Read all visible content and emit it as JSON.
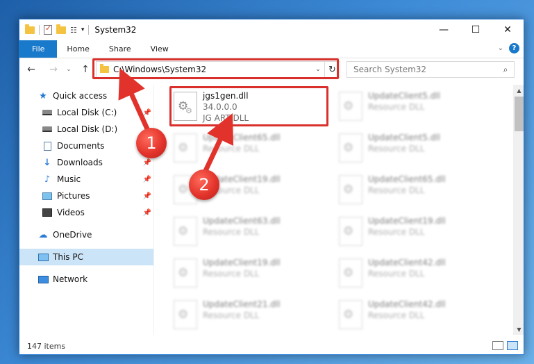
{
  "window": {
    "title": "System32",
    "minimize_glyph": "—",
    "maximize_glyph": "☐",
    "close_glyph": "✕"
  },
  "quick_access_toolbar": {
    "view_glyph": "☷",
    "caret_glyph": "▾"
  },
  "ribbon": {
    "tabs": [
      "File",
      "Home",
      "Share",
      "View"
    ],
    "help_label": "?",
    "expand_glyph": "⌄"
  },
  "nav": {
    "back_glyph": "←",
    "forward_glyph": "→",
    "recent_glyph": "⌄",
    "up_glyph": "↑"
  },
  "address_bar": {
    "path": "C:\\Windows\\System32",
    "dropdown_glyph": "⌄",
    "refresh_glyph": "↻"
  },
  "search": {
    "placeholder": "Search System32",
    "icon_glyph": "⌕"
  },
  "sidebar": {
    "items": [
      {
        "label": "Quick access",
        "icon": "star-icon"
      },
      {
        "label": "Local Disk (C:)",
        "icon": "drive-icon",
        "pinned": true
      },
      {
        "label": "Local Disk (D:)",
        "icon": "drive-icon"
      },
      {
        "label": "Documents",
        "icon": "documents-icon"
      },
      {
        "label": "Downloads",
        "icon": "download-icon",
        "pinned": true
      },
      {
        "label": "Music",
        "icon": "music-icon",
        "pinned": true
      },
      {
        "label": "Pictures",
        "icon": "pictures-icon",
        "pinned": true
      },
      {
        "label": "Videos",
        "icon": "videos-icon",
        "pinned": true
      },
      {
        "label": "OneDrive",
        "icon": "cloud-icon"
      },
      {
        "label": "This PC",
        "icon": "computer-icon",
        "selected": true
      },
      {
        "label": "Network",
        "icon": "network-icon"
      }
    ]
  },
  "files": [
    {
      "name": "jgs1gen.dll",
      "line2": "34.0.0.0",
      "line3": "JG ART DLL",
      "highlighted": true
    },
    {
      "name": "UpdateClient5.dll",
      "line2": "Resource DLL"
    },
    {
      "name": "UpdateClient65.dll",
      "line2": "Resource DLL"
    },
    {
      "name": "UpdateClient5.dll",
      "line2": "Resource DLL"
    },
    {
      "name": "UpdateClient19.dll",
      "line2": "Resource DLL"
    },
    {
      "name": "UpdateClient65.dll",
      "line2": "Resource DLL"
    },
    {
      "name": "UpdateClient63.dll",
      "line2": "Resource DLL"
    },
    {
      "name": "UpdateClient19.dll",
      "line2": "Resource DLL"
    },
    {
      "name": "UpdateClient19.dll",
      "line2": "Resource DLL"
    },
    {
      "name": "UpdateClient42.dll",
      "line2": "Resource DLL"
    },
    {
      "name": "UpdateClient21.dll",
      "line2": "Resource DLL"
    },
    {
      "name": "UpdateClient42.dll",
      "line2": "Resource DLL"
    }
  ],
  "status_bar": {
    "item_count": "147 items"
  },
  "annotations": {
    "step1": "1",
    "step2": "2",
    "color": "#d9302c"
  },
  "scrollbar": {
    "up_glyph": "▲",
    "down_glyph": "▼"
  }
}
